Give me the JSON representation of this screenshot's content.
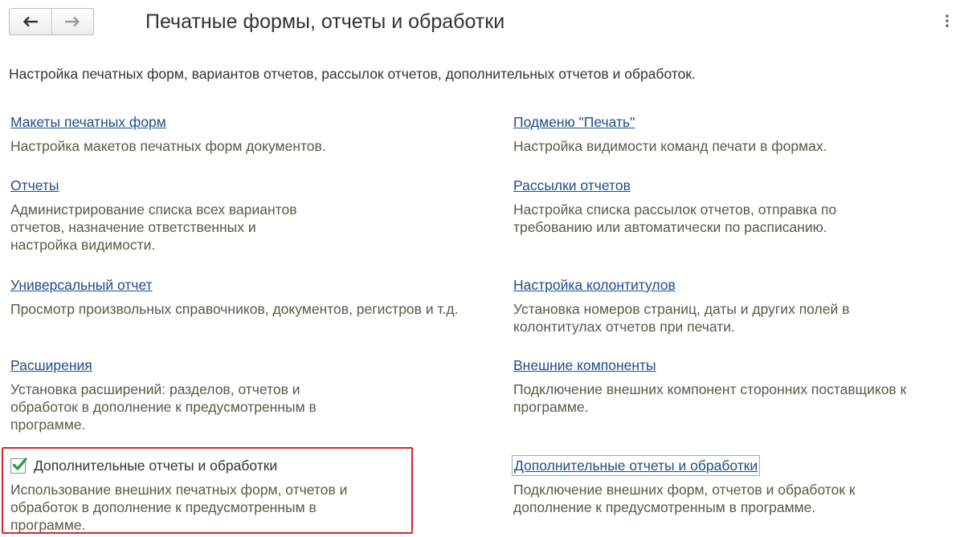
{
  "header": {
    "title": "Печатные формы, отчеты и обработки",
    "back_icon": "arrow-left-icon",
    "forward_icon": "arrow-right-icon",
    "more_icon": "vertical-dots-icon"
  },
  "description": "Настройка печатных форм, вариантов отчетов, рассылок отчетов, дополнительных отчетов и обработок.",
  "left_column": [
    {
      "link": "Макеты печатных форм",
      "desc": "Настройка макетов печатных форм документов."
    },
    {
      "link": "Отчеты",
      "desc_lines": [
        "Администрирование списка всех вариантов",
        "отчетов, назначение ответственных и",
        "настройка видимости."
      ]
    },
    {
      "link": "Универсальный отчет",
      "desc": "Просмотр произвольных справочников, документов, регистров и т.д."
    },
    {
      "link": "Расширения",
      "desc_lines": [
        "Установка расширений: разделов, отчетов и",
        "обработок в дополнение к предусмотренным в",
        "программе."
      ]
    }
  ],
  "right_column": [
    {
      "link": "Подменю \"Печать\"",
      "desc": "Настройка видимости команд печати в формах."
    },
    {
      "link": "Рассылки отчетов",
      "desc_lines": [
        "Настройка списка рассылок отчетов, отправка по",
        "требованию или автоматически по расписанию."
      ]
    },
    {
      "link": "Настройка колонтитулов",
      "desc_lines": [
        "Установка номеров страниц, даты и других полей в",
        "колонтитулах отчетов при печати."
      ]
    },
    {
      "link": "Внешние компоненты",
      "desc_lines": [
        "Подключение внешних компонент сторонних поставщиков к",
        "программе."
      ]
    }
  ],
  "additional_checkbox": {
    "label": "Дополнительные отчеты и обработки",
    "checked": true,
    "desc_lines": [
      "Использование внешних печатных форм, отчетов и",
      "обработок в дополнение к предусмотренным в",
      "программе."
    ]
  },
  "additional_link": {
    "link": "Дополнительные отчеты и обработки",
    "desc_lines": [
      "Подключение внешних форм, отчетов и обработок к",
      "дополнение к предусмотренным в программе."
    ]
  },
  "colors": {
    "link": "#1c4e8c",
    "description_text": "#5a5a45",
    "highlight_border": "#d9252a",
    "checkmark": "#1e9e3b"
  }
}
